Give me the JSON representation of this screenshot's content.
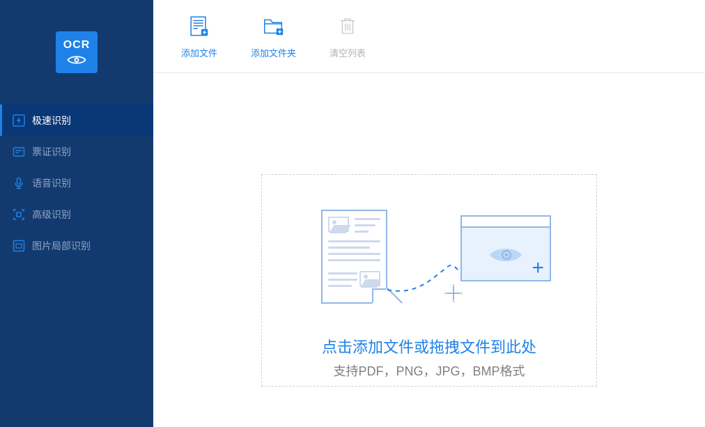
{
  "logo": {
    "text": "OCR"
  },
  "sidebar": {
    "items": [
      {
        "label": "极速识别",
        "icon": "bolt-icon",
        "active": true
      },
      {
        "label": "票证识别",
        "icon": "ticket-icon"
      },
      {
        "label": "语音识别",
        "icon": "mic-icon"
      },
      {
        "label": "高级识别",
        "icon": "scan-icon"
      },
      {
        "label": "图片局部识别",
        "icon": "crop-icon"
      }
    ]
  },
  "toolbar": {
    "add_file_label": "添加文件",
    "add_folder_label": "添加文件夹",
    "clear_list_label": "清空列表"
  },
  "dropzone": {
    "title": "点击添加文件或拖拽文件到此处",
    "subtitle": "支持PDF，PNG，JPG，BMP格式"
  },
  "colors": {
    "accent": "#1e82e8",
    "sidebar_bg": "#133a6e"
  }
}
